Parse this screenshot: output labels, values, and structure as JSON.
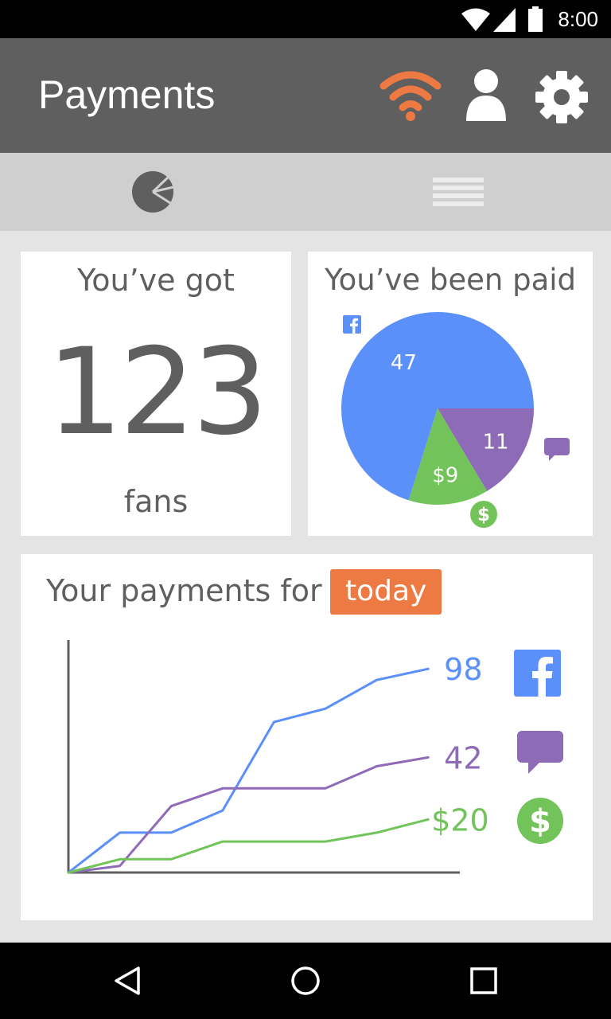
{
  "status_bar": {
    "time": "8:00"
  },
  "app_bar": {
    "title": "Payments"
  },
  "tabs": [
    {
      "icon": "pie-chart-icon"
    },
    {
      "icon": "list-icon"
    }
  ],
  "fans_card": {
    "heading": "You’ve got",
    "count": "123",
    "unit": "fans"
  },
  "paid_card": {
    "heading": "You’ve been paid"
  },
  "payments_card": {
    "heading": "Your payments for",
    "period": "today"
  },
  "colors": {
    "facebook": "#5b8ff9",
    "messages": "#8e6bb6",
    "money": "#72c35a",
    "accent": "#ee7a43",
    "app_bar": "#5f5f5f"
  },
  "chart_data": [
    {
      "type": "pie",
      "slices": [
        {
          "label": "47",
          "value": 47,
          "icon": "facebook-icon",
          "color": "#5b8ff9"
        },
        {
          "label": "11",
          "value": 11,
          "icon": "message-icon",
          "color": "#8e6bb6"
        },
        {
          "label": "$9",
          "value": 9,
          "icon": "dollar-icon",
          "color": "#72c35a"
        }
      ]
    },
    {
      "type": "line",
      "grid": false,
      "x": [
        0,
        1,
        2,
        3,
        4,
        5,
        6,
        7
      ],
      "xlim": [
        0,
        7.5
      ],
      "ylim": [
        0,
        105
      ],
      "series": [
        {
          "color": "#5b8ff9",
          "icon": "facebook-icon",
          "end_label": "98",
          "values": [
            0,
            18,
            18,
            28,
            68,
            74,
            87,
            92
          ]
        },
        {
          "color": "#8e6bb6",
          "icon": "message-icon",
          "end_label": "42",
          "values": [
            0,
            3,
            30,
            38,
            38,
            38,
            48,
            52
          ]
        },
        {
          "color": "#72c35a",
          "icon": "dollar-icon",
          "end_label": "$20",
          "values": [
            0,
            6,
            6,
            14,
            14,
            14,
            18,
            24
          ]
        }
      ]
    }
  ]
}
